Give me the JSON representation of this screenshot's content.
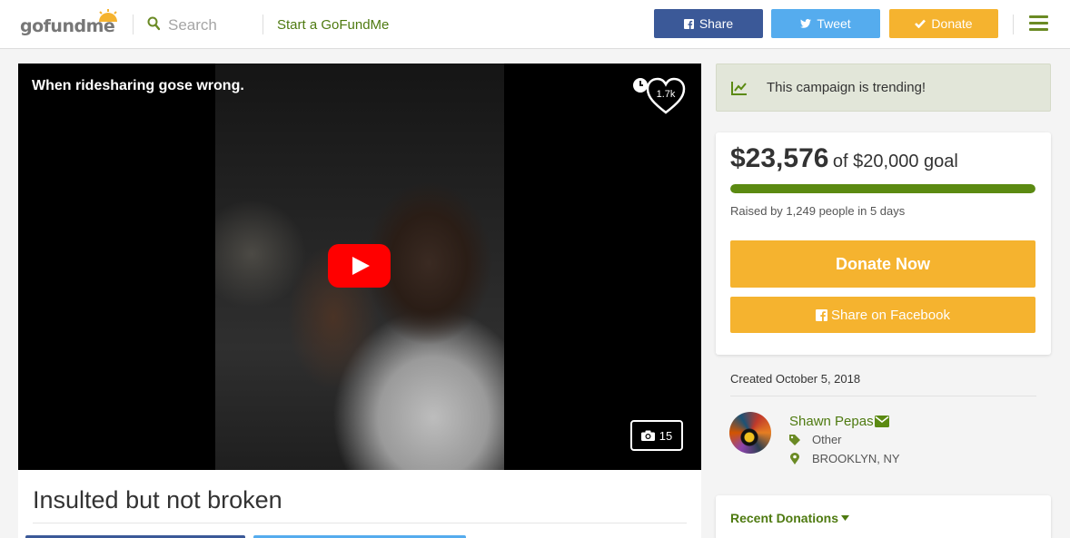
{
  "header": {
    "logo_text": "gofundme",
    "search_placeholder": "Search",
    "start_link": "Start a GoFundMe",
    "share_label": "Share",
    "tweet_label": "Tweet",
    "donate_label": "Donate"
  },
  "video": {
    "title": "When ridesharing gose wrong.",
    "like_count": "1.7k",
    "photo_count": "15"
  },
  "campaign": {
    "title": "Insulted but not broken"
  },
  "sidebar": {
    "trending_text": "This campaign is trending!",
    "raised_amount": "$23,576",
    "goal_text": "of $20,000 goal",
    "progress_fraction": 1.0,
    "raised_by": "Raised by 1,249 people in 5 days",
    "donate_now": "Donate Now",
    "share_facebook": "Share on Facebook",
    "created": "Created October 5, 2018",
    "organizer": {
      "name": "Shawn Pepas",
      "category": "Other",
      "location": "BROOKLYN, NY"
    },
    "recent_donations": "Recent Donations"
  },
  "colors": {
    "brand_green": "#4e7a10",
    "facebook_blue": "#3b5998",
    "twitter_blue": "#55acee",
    "donate_orange": "#f5b32f",
    "progress_green": "#5b8a12"
  },
  "icons": [
    "logo-sun-icon",
    "search-icon",
    "facebook-icon",
    "twitter-icon",
    "check-icon",
    "menu-icon",
    "clock-icon",
    "heart-icon",
    "play-icon",
    "camera-icon",
    "trending-chart-icon",
    "mail-icon",
    "tag-icon",
    "map-pin-icon",
    "caret-down-icon"
  ]
}
